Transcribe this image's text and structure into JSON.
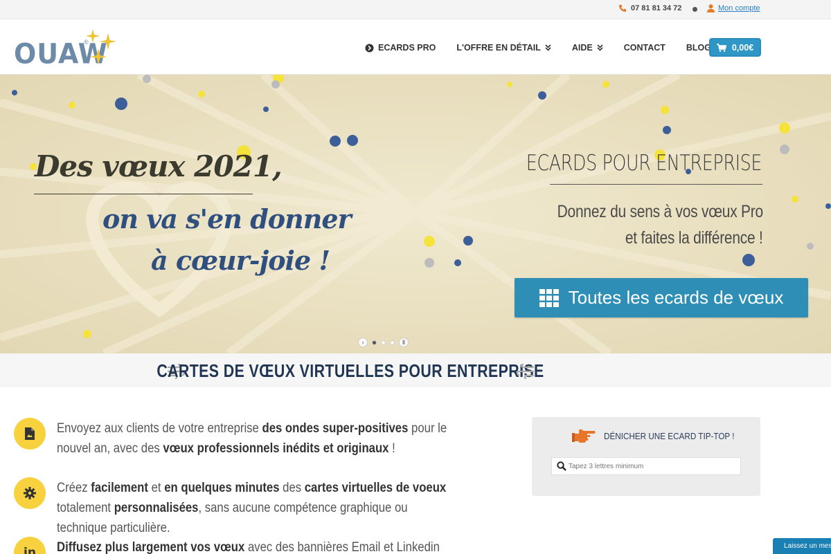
{
  "topbar": {
    "phone": "07 81 81 34 72",
    "account": "Mon compte"
  },
  "header": {
    "logo_text": "OUAW",
    "logo_reg": "®",
    "nav": [
      {
        "label": "ECARDS PRO",
        "icon": "circle-chevron-right-icon"
      },
      {
        "label": "L'OFFRE EN DÉTAIL",
        "icon": "double-chevron-down-icon"
      },
      {
        "label": "AIDE",
        "icon": "double-chevron-down-icon"
      },
      {
        "label": "CONTACT"
      },
      {
        "label": "BLOG"
      }
    ],
    "cart_total": "0,00€"
  },
  "hero": {
    "line1": "Des vœux 2021,",
    "line2": "on va s'en donner",
    "line3": "à cœur-joie !",
    "ecards_title": "ECARDS POUR ENTREPRISE",
    "sub1": "Donnez du sens à vos vœux Pro",
    "sub2": "et faites la différence !",
    "cta": "Toutes les ecards de vœux",
    "colors": {
      "background": "#ece4c6",
      "blue": "#2f4f7e",
      "yellow": "#f5e23a",
      "cta": "#2f8eb5"
    }
  },
  "section": {
    "title": "CARTES DE VŒUX VIRTUELLES POUR ENTREPRISE"
  },
  "features": [
    {
      "icon": "document-icon",
      "parts": [
        "Envoyez aux clients de votre entreprise ",
        "des ondes super-positives",
        " pour le nouvel an, avec des ",
        "vœux professionnels inédits et originaux",
        " !"
      ]
    },
    {
      "icon": "gear-icon",
      "parts": [
        "Créez ",
        "facilement",
        " et ",
        "en quelques minutes",
        " des ",
        "cartes virtuelles de voeux",
        " totalement ",
        "personnalisées",
        ", sans aucune compétence graphique ou technique particulière."
      ]
    },
    {
      "icon": "linkedin-icon",
      "parts": [
        "Diffusez plus largement vos vœux",
        " avec des bannières Email et Linkedin"
      ]
    }
  ],
  "search_panel": {
    "label": "DÉNICHER UNE ECARD TIP-TOP !",
    "placeholder": "Tapez 3 lettres minimum"
  },
  "chat": {
    "label": "Laissez un message"
  }
}
